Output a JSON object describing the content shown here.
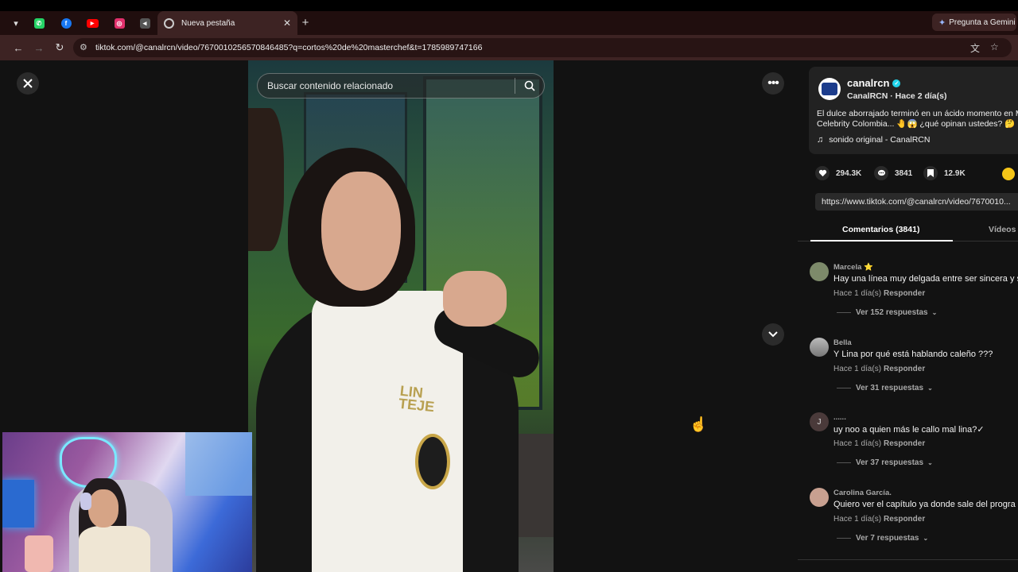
{
  "browser": {
    "active_tab_title": "Nueva pestaña",
    "url": "tiktok.com/@canalrcn/video/7670010256570846485?q=cortos%20de%20masterchef&t=1785989747166",
    "gemini_label": "Pregunta a Gemini",
    "pinned_tabs": [
      {
        "name": "whatsapp-tab",
        "color": "#25d366",
        "glyph": "✆"
      },
      {
        "name": "facebook-tab",
        "color": "#1877f2",
        "glyph": "f"
      },
      {
        "name": "youtube-tab",
        "color": "#ff0000",
        "glyph": "▶"
      },
      {
        "name": "instagram-tab",
        "color": "#e1306c",
        "glyph": "◎"
      },
      {
        "name": "audio-tab",
        "color": "#555555",
        "glyph": "🔊"
      }
    ]
  },
  "video": {
    "search_placeholder": "Buscar contenido relacionado",
    "apron_text": "LIN\nTEJE"
  },
  "post": {
    "username": "canalrcn",
    "subline": "CanalRCN · Hace 2 día(s)",
    "description": "El dulce aborrajado terminó en un ácido momento en M Celebrity Colombia... 🤚😱 ¿qué opinan ustedes? 🤔",
    "sound": "sonido original - CanalRCN",
    "likes": "294.3K",
    "comments": "3841",
    "saves": "12.9K",
    "link": "https://www.tiktok.com/@canalrcn/video/7670010..."
  },
  "tabs": {
    "comments": "Comentarios (3841)",
    "videos": "Vídeos c"
  },
  "comments": [
    {
      "name": "Marcela ⭐",
      "text": "Hay una línea muy delgada entre ser sincera y s",
      "time": "Hace 1 día(s)",
      "reply": "Responder",
      "view": "Ver 152 respuestas",
      "avatar": "#7d8a6a",
      "initial": ""
    },
    {
      "name": "Bella",
      "text": "Y Lina por qué está hablando caleño ???",
      "time": "Hace 1 día(s)",
      "reply": "Responder",
      "view": "Ver 31 respuestas",
      "avatar": "#9a9a9a",
      "initial": ""
    },
    {
      "name": "......",
      "text": "uy noo a quien más le callo mal lina?✓",
      "time": "Hace 1 día(s)",
      "reply": "Responder",
      "view": "Ver 37 respuestas",
      "avatar": "#4a3a3a",
      "initial": "J"
    },
    {
      "name": "Carolina García.",
      "text": "Quiero ver el capítulo ya donde sale del progra",
      "time": "Hace 1 día(s)",
      "reply": "Responder",
      "view": "Ver 7 respuestas",
      "avatar": "#c8a090",
      "initial": ""
    }
  ]
}
